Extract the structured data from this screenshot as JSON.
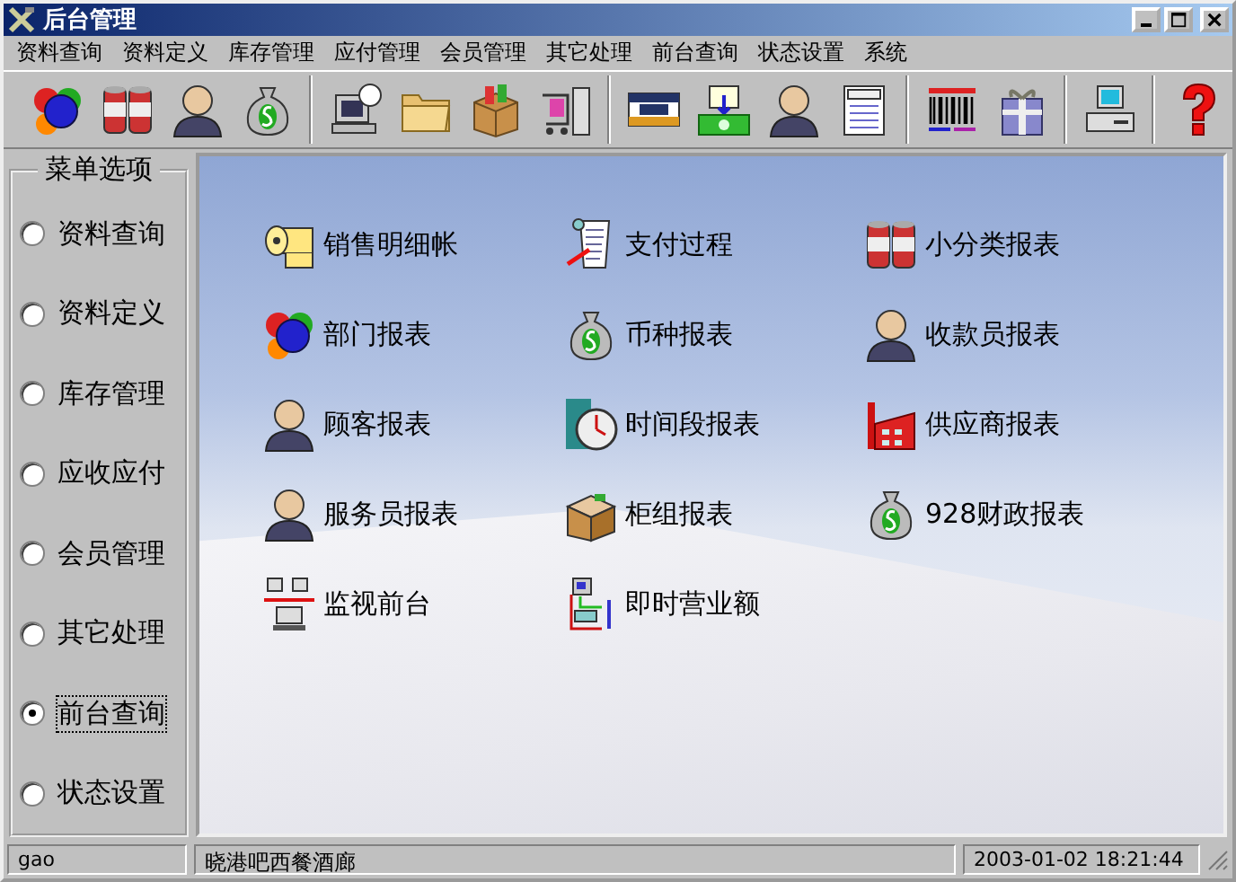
{
  "window": {
    "title": "后台管理"
  },
  "menu": [
    "资料查询",
    "资料定义",
    "库存管理",
    "应付管理",
    "会员管理",
    "其它处理",
    "前台查询",
    "状态设置",
    "系统"
  ],
  "sidebar": {
    "title": "菜单选项",
    "items": [
      {
        "label": "资料查询",
        "selected": false
      },
      {
        "label": "资料定义",
        "selected": false
      },
      {
        "label": "库存管理",
        "selected": false
      },
      {
        "label": "应收应付",
        "selected": false
      },
      {
        "label": "会员管理",
        "selected": false
      },
      {
        "label": "其它处理",
        "selected": false
      },
      {
        "label": "前台查询",
        "selected": true
      },
      {
        "label": "状态设置",
        "selected": false
      }
    ]
  },
  "reports": [
    "销售明细帐",
    "支付过程",
    "小分类报表",
    "部门报表",
    "币种报表",
    "收款员报表",
    "顾客报表",
    "时间段报表",
    "供应商报表",
    "服务员报表",
    "柜组报表",
    "928财政报表",
    "监视前台",
    "即时营业额"
  ],
  "status_bar": {
    "user": "gao",
    "shop": "晓港吧西餐酒廊",
    "datetime": "2003-01-02  18:21:44"
  }
}
